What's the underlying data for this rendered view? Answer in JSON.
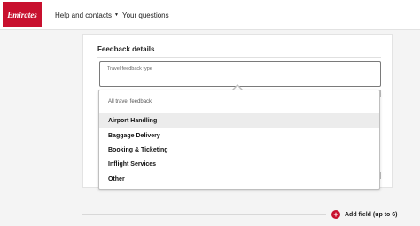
{
  "header": {
    "logo_text": "Emirates",
    "nav": {
      "help_label": "Help and contacts",
      "questions_label": "Your questions"
    }
  },
  "form": {
    "section_title": "Feedback details",
    "select_label": "Travel feedback type"
  },
  "dropdown": {
    "header": "All travel feedback",
    "options": [
      {
        "label": "Airport Handling"
      },
      {
        "label": "Baggage Delivery"
      },
      {
        "label": "Booking & Ticketing"
      },
      {
        "label": "Inflight Services"
      },
      {
        "label": "Other"
      }
    ],
    "highlighted_option": "Airport Handling"
  },
  "footer": {
    "add_field_label": "Add field (up to 6)"
  },
  "colors": {
    "brand_red": "#c8102e",
    "highlight_bg": "#ececec"
  }
}
